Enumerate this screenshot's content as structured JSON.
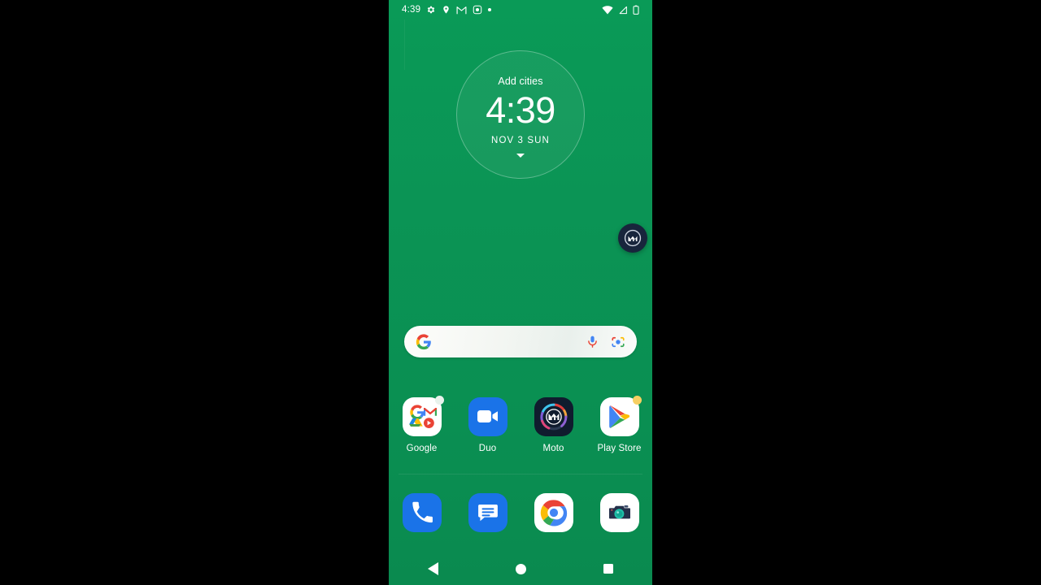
{
  "device": {
    "wallpaper_color": "#0b9455",
    "screen_label": "android-home-screen"
  },
  "status_bar": {
    "time": "4:39",
    "left_icons": [
      {
        "name": "settings-gear-icon",
        "label": "Settings"
      },
      {
        "name": "location-pin-icon",
        "label": "Location"
      },
      {
        "name": "gmail-icon",
        "label": "Gmail"
      },
      {
        "name": "screen-record-icon",
        "label": "Screen recording"
      },
      {
        "name": "more-notifications-dot-icon",
        "label": "More notifications"
      }
    ],
    "right_icons": [
      {
        "name": "wifi-icon",
        "label": "Wi-Fi"
      },
      {
        "name": "cellular-signal-icon",
        "label": "Signal"
      },
      {
        "name": "battery-icon",
        "label": "Battery"
      }
    ]
  },
  "clock_widget": {
    "add_cities_label": "Add cities",
    "time": "4:39",
    "date": "NOV  3  SUN",
    "expand_icon": "chevron-down-icon"
  },
  "moto_bubble": {
    "label": "Moto",
    "icon": "motorola-logo-icon",
    "background": "#18253c"
  },
  "search": {
    "placeholder": "",
    "value": "",
    "logo_icon": "google-g-icon",
    "mic_icon": "microphone-icon",
    "lens_icon": "google-lens-icon"
  },
  "apps": [
    {
      "name": "google-folder",
      "label": "Google",
      "icon": "google-folder-icon",
      "badge": true,
      "badge_color": "#e8f2ec"
    },
    {
      "name": "duo",
      "label": "Duo",
      "icon": "duo-icon",
      "badge": false,
      "badge_color": ""
    },
    {
      "name": "moto",
      "label": "Moto",
      "icon": "moto-icon",
      "badge": false,
      "badge_color": ""
    },
    {
      "name": "play-store",
      "label": "Play Store",
      "icon": "play-store-icon",
      "badge": true,
      "badge_color": "#f6cf63"
    }
  ],
  "dock": [
    {
      "name": "phone",
      "label": "Phone",
      "icon": "phone-icon"
    },
    {
      "name": "messages",
      "label": "Messages",
      "icon": "messages-icon"
    },
    {
      "name": "chrome",
      "label": "Chrome",
      "icon": "chrome-icon"
    },
    {
      "name": "camera",
      "label": "Camera",
      "icon": "camera-icon"
    }
  ],
  "nav_bar": {
    "back_label": "Back",
    "home_label": "Home",
    "recents_label": "Recent apps"
  }
}
